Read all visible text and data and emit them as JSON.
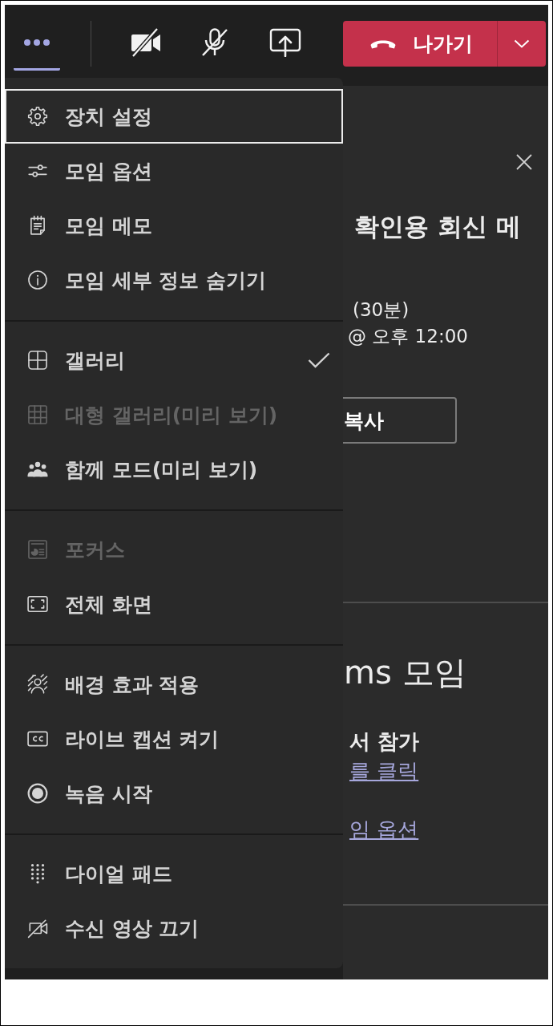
{
  "toolbar": {
    "buttons": [
      {
        "kind": "more",
        "selected": true,
        "off": false
      },
      {
        "kind": "camera",
        "selected": false,
        "off": true
      },
      {
        "kind": "mic",
        "selected": false,
        "off": true
      },
      {
        "kind": "share",
        "selected": false,
        "off": false
      }
    ],
    "leave_button": {
      "label": "나가기"
    }
  },
  "menu": {
    "sections": [
      {
        "items": [
          {
            "label": "장치 설정",
            "focused": true,
            "disabled": false,
            "checked": false
          },
          {
            "label": "모임 옵션",
            "focused": false,
            "disabled": false,
            "checked": false
          },
          {
            "label": "모임 메모",
            "focused": false,
            "disabled": false,
            "checked": false
          },
          {
            "label": "모임 세부 정보 숨기기",
            "focused": false,
            "disabled": false,
            "checked": false
          }
        ]
      },
      {
        "items": [
          {
            "label": "갤러리",
            "focused": false,
            "disabled": false,
            "checked": true
          },
          {
            "label": "대형 갤러리(미리 보기)",
            "focused": false,
            "disabled": true,
            "checked": false
          },
          {
            "label": "함께 모드(미리 보기)",
            "focused": false,
            "disabled": false,
            "checked": false
          }
        ]
      },
      {
        "items": [
          {
            "label": "포커스",
            "focused": false,
            "disabled": true,
            "checked": false
          },
          {
            "label": "전체 화면",
            "focused": false,
            "disabled": false,
            "checked": false
          }
        ]
      },
      {
        "items": [
          {
            "label": "배경 효과 적용",
            "focused": false,
            "disabled": false,
            "checked": false
          },
          {
            "label": "라이브 캡션 켜기",
            "focused": false,
            "disabled": false,
            "checked": false
          },
          {
            "label": "녹음 시작",
            "focused": false,
            "disabled": false,
            "checked": false
          }
        ]
      },
      {
        "items": [
          {
            "label": "다이얼 패드",
            "focused": false,
            "disabled": false,
            "checked": false
          },
          {
            "label": "수신 영상 끄기",
            "focused": false,
            "disabled": false,
            "checked": false
          }
        ]
      }
    ]
  },
  "details_panel": {
    "title": "확인용 회신 메",
    "duration": "(30분)",
    "time": "@ 오후 12:00",
    "copy_button": "복사",
    "heading": "ms 모임",
    "join_label": "서 참가",
    "links": [
      "를 클릭",
      "임 옵션"
    ]
  }
}
